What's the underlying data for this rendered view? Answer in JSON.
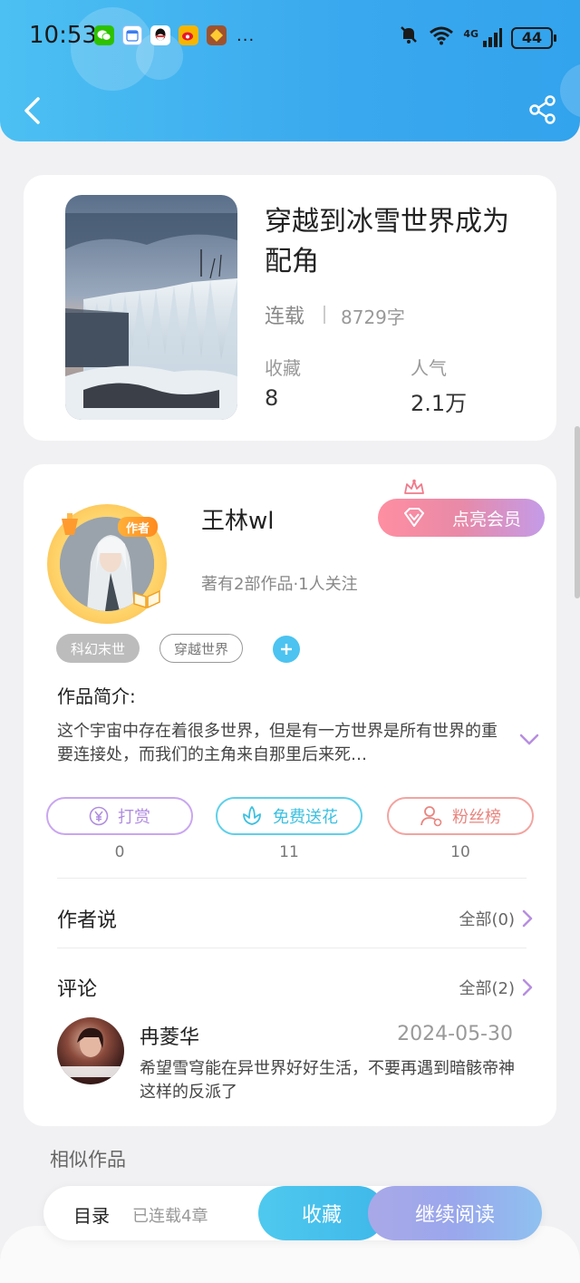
{
  "status_bar": {
    "time": "10:53",
    "battery": "44",
    "network": "4G",
    "overflow": "..."
  },
  "header": {
    "back_icon": "chevron-left-icon",
    "share_icon": "share-icon"
  },
  "book": {
    "title": "穿越到冰雪世界成为配角",
    "status": "连载",
    "word_count": "8729字",
    "stats": [
      {
        "label": "收藏",
        "value": "8"
      },
      {
        "label": "人气",
        "value": "2.1万"
      }
    ]
  },
  "author": {
    "name": "王林wl",
    "badge": "作者",
    "meta": "著有2部作品·1人关注",
    "vip_label": "点亮会员"
  },
  "tags": [
    "科幻末世",
    "穿越世界"
  ],
  "intro": {
    "title": "作品简介:",
    "text": "这个宇宙中存在着很多世界，但是有一方世界是所有世界的重要连接处，而我们的主角来自那里后来死…"
  },
  "actions": [
    {
      "label": "打赏",
      "count": "0",
      "icon": "yen-coin-icon"
    },
    {
      "label": "免费送花",
      "count": "11",
      "icon": "flower-icon"
    },
    {
      "label": "粉丝榜",
      "count": "10",
      "icon": "user-rank-icon"
    }
  ],
  "author_says": {
    "title": "作者说",
    "link": "全部(0)"
  },
  "comments": {
    "title": "评论",
    "link": "全部(2)",
    "items": [
      {
        "name": "冉菱华",
        "date": "2024-05-30",
        "text": "希望雪穹能在异世界好好生活，不要再遇到暗骸帝神这样的反派了"
      }
    ]
  },
  "similar": {
    "title": "相似作品"
  },
  "bottom_bar": {
    "toc_label": "目录",
    "chapters": "已连载4章",
    "favorite_label": "收藏",
    "read_label": "继续阅读"
  },
  "colors": {
    "header": "#3aa8ee",
    "accent_cyan": "#4cc3f0",
    "vip_pink": "#ff8ea1",
    "vip_purple": "#c49be8"
  }
}
